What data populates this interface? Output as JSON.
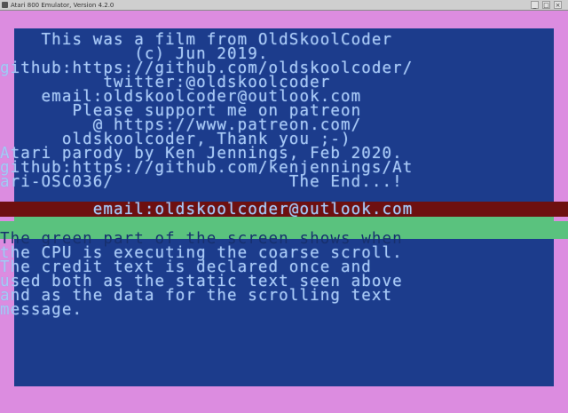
{
  "window": {
    "title": "Atari 800 Emulator, Version 4.2.0",
    "buttons": {
      "minimize": "_",
      "maximize": "□",
      "close": "×"
    }
  },
  "screen": {
    "credits": [
      "    This was a film from OldSkoolCoder",
      "             (c) Jun 2019.",
      "github:https://github.com/oldskoolcoder/",
      "          twitter:@oldskoolcoder",
      "    email:oldskoolcoder@outlook.com",
      "       Please support me on patreon",
      "         @ https://www.patreon.com/",
      "      oldskoolcoder, Thank you ;-)",
      "Atari parody by Ken Jennings, Feb 2020.",
      "github:https://github.com/kenjennings/At",
      "ari-OSC036/                 The End...!"
    ],
    "scroll_text": "         email:oldskoolcoder@outlook.com",
    "explanation": [
      "The green part of the screen shows when",
      "the CPU is executing the coarse scroll.",
      "The credit text is declared once and",
      "used both as the static text seen above",
      "and as the data for the scrolling text",
      "message."
    ]
  },
  "colors": {
    "border": "#dc8ce0",
    "playfield": "#1c3c8c",
    "text": "#a8c8f4",
    "green_band": "#5ac27e",
    "dark_band": "#6e1010"
  }
}
